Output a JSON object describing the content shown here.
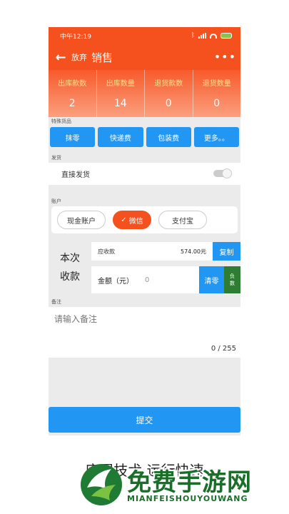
{
  "status": {
    "time": "中午12:19"
  },
  "toolbar": {
    "back": "←",
    "giveup": "放弃",
    "title": "销售",
    "more": "•••"
  },
  "stats": [
    {
      "label": "出库款数",
      "value": "2"
    },
    {
      "label": "出库数量",
      "value": "14"
    },
    {
      "label": "退货款数",
      "value": "0"
    },
    {
      "label": "退货数量",
      "value": "0"
    }
  ],
  "special": {
    "label": "特殊货品",
    "buttons": [
      "抹零",
      "快递费",
      "包装费",
      "更多。。"
    ]
  },
  "shipping": {
    "label": "发货",
    "direct": "直接发货",
    "direct_on": false
  },
  "account": {
    "label": "账户",
    "options": [
      "现金账户",
      "微信",
      "支付宝"
    ],
    "selected": "微信"
  },
  "payment": {
    "title_line1": "本次",
    "title_line2": "收款",
    "receivable_label": "应收款",
    "receivable_amount": "574.00元",
    "copy": "复制",
    "amount_label": "金额（元）",
    "amount_value": "0",
    "clear": "清零",
    "negative": "负数"
  },
  "note": {
    "label": "备注",
    "placeholder": "请输入备注",
    "counter": "0 / 255"
  },
  "submit": "提交",
  "tagline": "底层技术 运行快速",
  "watermark": {
    "title": "免费手游网",
    "subtitle": "MIANFEISHOUYOUWANG"
  },
  "colors": {
    "accent": "#f4511e",
    "button": "#2196f3",
    "negative": "#2e7d32",
    "stat_label": "#ffe08a"
  }
}
